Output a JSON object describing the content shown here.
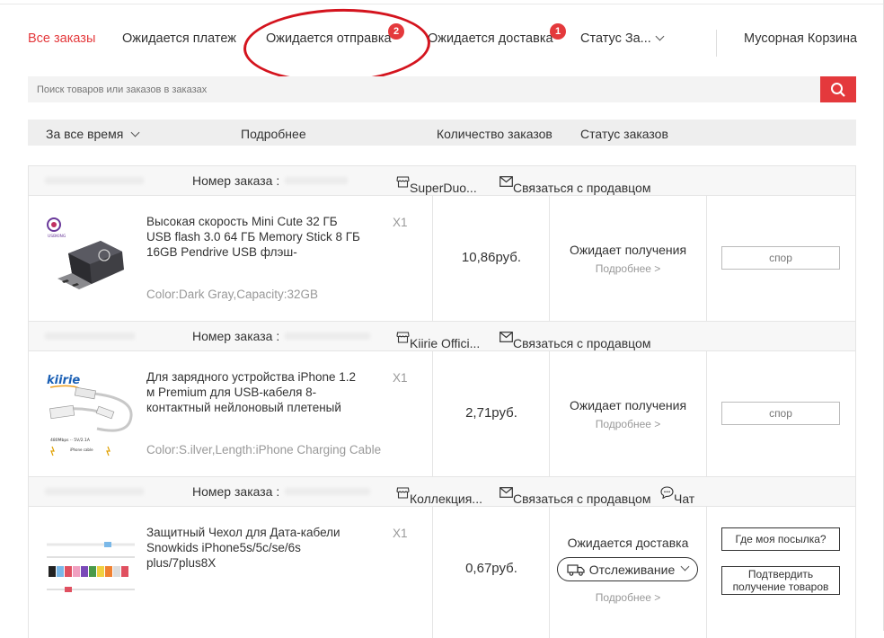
{
  "tabs": [
    {
      "label": "Все заказы",
      "active": true
    },
    {
      "label": "Ожидается платеж"
    },
    {
      "label": "Ожидается отправка",
      "badge": "2"
    },
    {
      "label": "Ожидается доставка",
      "badge": "1"
    },
    {
      "label": "Статус За..."
    },
    {
      "label": "Мусорная Корзина"
    }
  ],
  "search": {
    "placeholder": "Поиск товаров или заказов в заказах"
  },
  "filters": {
    "period": "За все время",
    "details": "Подробнее",
    "order_count": "Количество заказов",
    "order_status": "Статус заказов"
  },
  "orders": [
    {
      "order_label": "Номер заказа :",
      "store": "SuperDuo...",
      "contact": "Связаться с продавцом",
      "title": "Высокая скорость Mini Cute 32 ГБ USB flash 3.0 64 ГБ Memory Stick 8 ГБ 16GB Pendrive USB флэш-",
      "attributes": "Color:Dark Gray,Capacity:32GB",
      "qty": "X1",
      "price": "10,86руб.",
      "status": "Ожидает получения",
      "details_link": "Подробнее >",
      "action": "спор"
    },
    {
      "order_label": "Номер заказа :",
      "store": "Kiirie Offici...",
      "contact": "Связаться с продавцом",
      "title": "Для зарядного устройства iPhone 1.2 м Premium для USB-кабеля 8-контактный нейлоновый плетеный",
      "attributes": "Color:S.ilver,Length:iPhone Charging Cable",
      "qty": "X1",
      "price": "2,71руб.",
      "status": "Ожидает получения",
      "details_link": "Подробнее >",
      "action": "спор",
      "brand_logo_text": "kiirie"
    },
    {
      "order_label": "Номер заказа :",
      "store": "Коллекция...",
      "contact": "Связаться с продавцом",
      "chat": "Чат",
      "title": "Защитный Чехол для Дата-кабели Snowkids iPhone5s/5c/se/6s plus/7plus8X",
      "qty": "X1",
      "price": "0,67руб.",
      "status": "Ожидается доставка",
      "tracking": "Отслеживание",
      "details_link": "Подробнее >",
      "action_primary": "Где моя посылка?",
      "action_secondary": "Подтвердить получение товаров"
    }
  ],
  "colors": {
    "accent": "#e4393c",
    "annotation": "#d4141e"
  },
  "icons": {
    "search": "search-icon",
    "store": "store-icon",
    "mail": "mail-icon",
    "chat": "chat-icon",
    "truck": "truck-icon"
  }
}
